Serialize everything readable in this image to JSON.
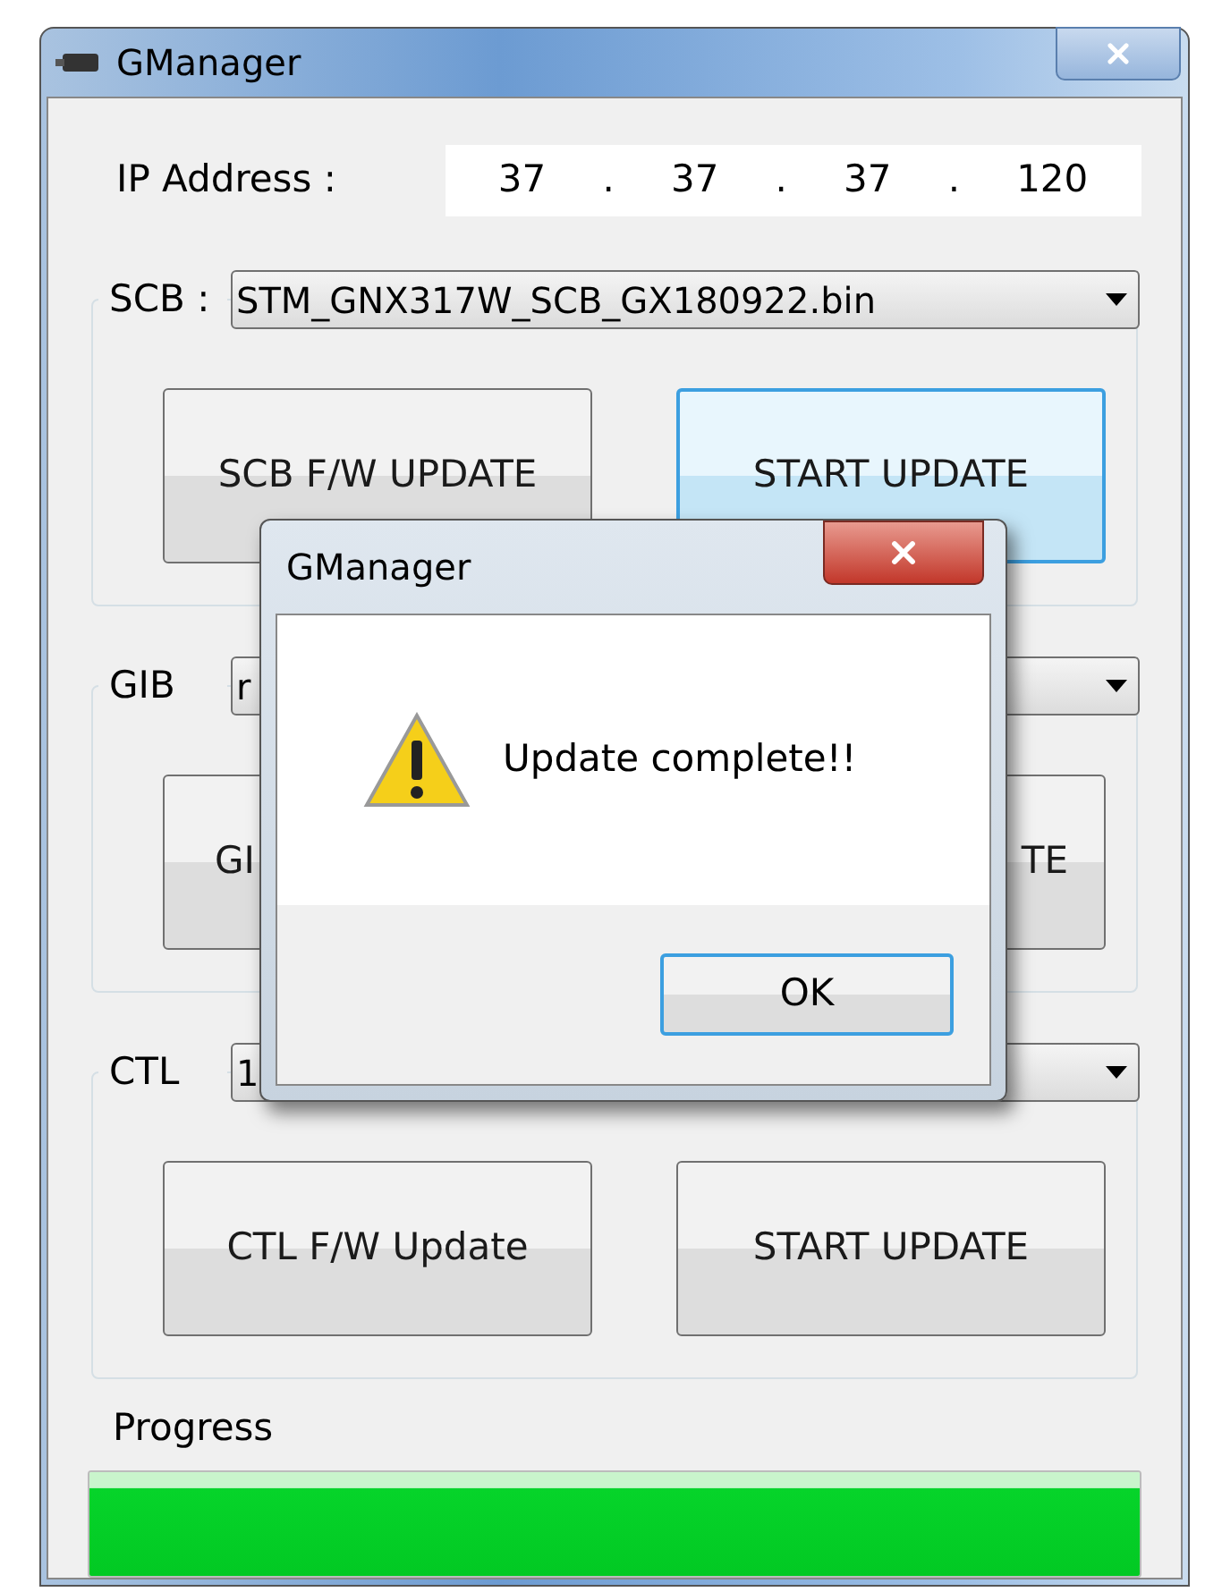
{
  "window": {
    "title": "GManager"
  },
  "ip_address": {
    "label": "IP Address :",
    "parts": [
      "37",
      ".",
      "37",
      ".",
      "37",
      ".",
      "120"
    ]
  },
  "sections": [
    {
      "label": "SCB :",
      "file": "STM_GNX317W_SCB_GX180922.bin",
      "buttons": [
        {
          "label": "SCB F/W UPDATE",
          "kind": "full",
          "hovered": false
        },
        {
          "label": "START UPDATE",
          "kind": "full",
          "hovered": true
        }
      ]
    },
    {
      "label": "GIB",
      "file": "r",
      "buttons": [
        {
          "label": "GI",
          "kind": "cut_end",
          "hovered": false
        },
        {
          "label": "TE",
          "kind": "cut_start",
          "hovered": false
        }
      ]
    },
    {
      "label": "CTL",
      "file": "1",
      "buttons": [
        {
          "label": "CTL F/W Update",
          "kind": "full",
          "hovered": false
        },
        {
          "label": "START UPDATE",
          "kind": "full",
          "hovered": false
        }
      ]
    }
  ],
  "progress": {
    "label": "Progress",
    "level": 1
  },
  "dialog": {
    "title": "GManager",
    "message": "Update complete!!",
    "button": "OK"
  }
}
